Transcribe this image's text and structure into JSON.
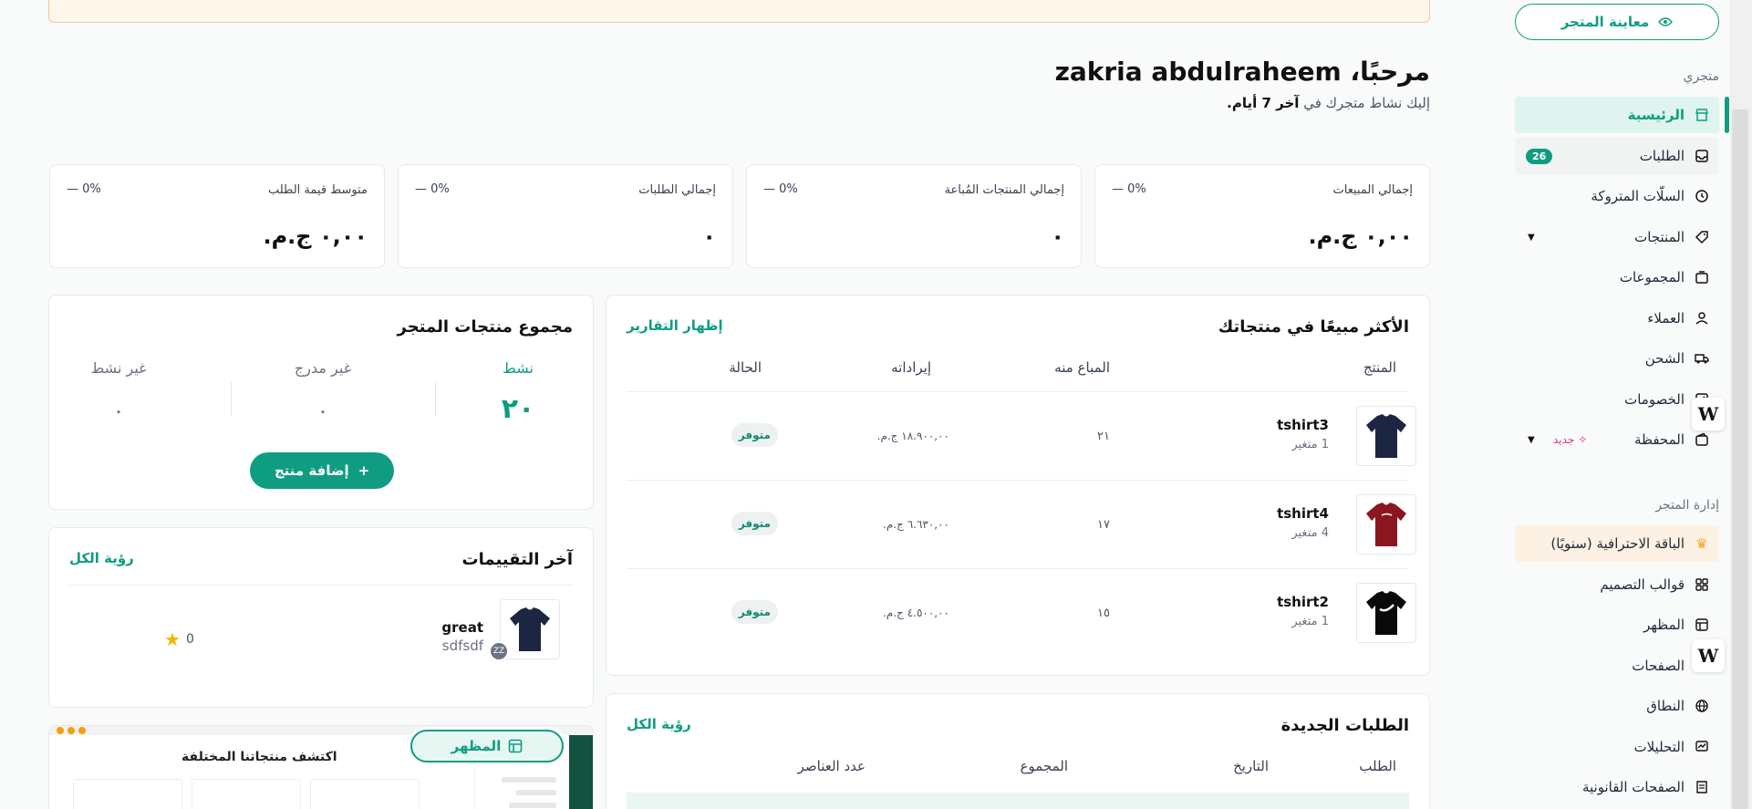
{
  "sidebar": {
    "preview_store": "معاينة المتجر",
    "section_store": "متجري",
    "section_manage": "إدارة المتجر",
    "items": [
      {
        "label": "الرئيسية"
      },
      {
        "label": "الطلبات",
        "count": "26"
      },
      {
        "label": "السلّات المتروكة"
      },
      {
        "label": "المنتجات"
      },
      {
        "label": "المجموعات"
      },
      {
        "label": "العملاء"
      },
      {
        "label": "الشحن"
      },
      {
        "label": "الخصومات"
      },
      {
        "label": "المحفظة",
        "badge": "جديد"
      }
    ],
    "manage_items": [
      {
        "label": "الباقة الاحترافية (سنويًا)"
      },
      {
        "label": "قوالب التصميم"
      },
      {
        "label": "المظهر"
      },
      {
        "label": "الصفحات"
      },
      {
        "label": "النطاق"
      },
      {
        "label": "التحليلات"
      },
      {
        "label": "الصفحات القانونية"
      }
    ]
  },
  "header": {
    "welcome": "مرحبًا، zakria abdulraheem",
    "subtitle_prefix": "إليك نشاط متجرك في",
    "subtitle_bold": "آخر 7 أيام."
  },
  "stats": [
    {
      "label": "إجمالي المبيعات",
      "value": "٠,٠٠ ج.م.",
      "change": "— 0%"
    },
    {
      "label": "إجمالي المنتجات المُباعة",
      "value": "٠",
      "change": "— 0%"
    },
    {
      "label": "إجمالي الطلبات",
      "value": "٠",
      "change": "— 0%"
    },
    {
      "label": "متوسط قيمة الطلب",
      "value": "٠,٠٠ ج.م.",
      "change": "— 0%"
    }
  ],
  "best_sellers": {
    "title": "الأكثر مبيعًا في منتجاتك",
    "link": "إظهار التقارير",
    "columns": [
      "المنتج",
      "المباع منه",
      "إيراداته",
      "الحالة"
    ],
    "rows": [
      {
        "name": "tshirt3",
        "variants": "1  متغير",
        "sold": "٢١",
        "revenue": "١٨.٩٠٠,٠٠ ج.م.",
        "status": "متوفر"
      },
      {
        "name": "tshirt4",
        "variants": "4  متغير",
        "sold": "١٧",
        "revenue": "٦.٦٣٠,٠٠ ج.م.",
        "status": "متوفر"
      },
      {
        "name": "tshirt2",
        "variants": "1  متغير",
        "sold": "١٥",
        "revenue": "٤.٥٠٠,٠٠ ج.م.",
        "status": "متوفر"
      }
    ]
  },
  "totals": {
    "title": "مجموع منتجات المتجر",
    "active_label": "نشط",
    "active_value": "٢٠",
    "unlisted_label": "غير مدرج",
    "unlisted_value": "٠",
    "inactive_label": "غير نشط",
    "inactive_value": "٠",
    "add_button": "إضافة منتج"
  },
  "reviews": {
    "title": "آخر التقييمات",
    "link": "رؤية الكل",
    "item": {
      "title": "great",
      "text": "sdfsdf",
      "avatar": "ZZ",
      "rating": "0"
    }
  },
  "new_orders": {
    "title": "الطلبات الجديدة",
    "link": "رؤية الكل",
    "columns": [
      "الطلب",
      "التاريخ",
      "المجموع",
      "عدد العناصر"
    ]
  },
  "theme_preview": {
    "chip": "المظهر",
    "heading": "اكتشف منتجاتنا المختلفة"
  },
  "colors": {
    "accent": "#0f9d82",
    "active_bg": "#e0f4ef",
    "warn_border": "#f4c79c"
  }
}
